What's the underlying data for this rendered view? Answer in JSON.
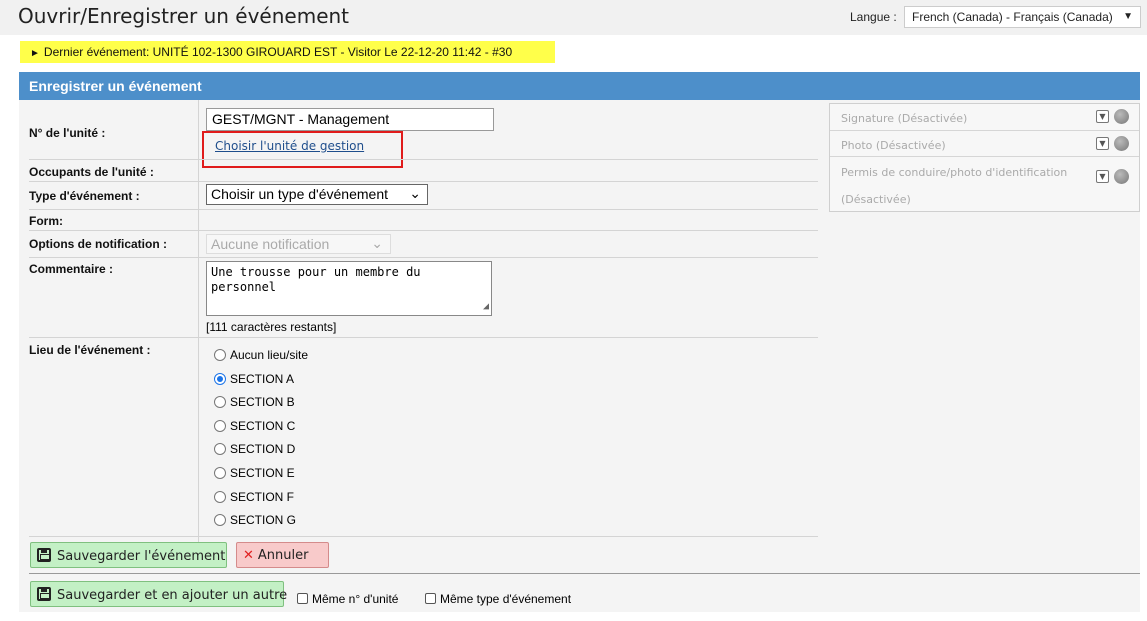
{
  "header": {
    "title": "Ouvrir/Enregistrer un événement",
    "language_label": "Langue :",
    "language_value": "French (Canada) - Français (Canada)"
  },
  "banner": {
    "text": "Dernier événement: UNITÉ 102-1300 GIROUARD EST - Visitor Le 22-12-20 11:42 - #30"
  },
  "panel": {
    "title": "Enregistrer un événement"
  },
  "form": {
    "unit_label": "N° de l'unité :",
    "unit_value": "GEST/MGNT - Management",
    "choose_unit_link": "Choisir l'unité de gestion",
    "occupants_label": "Occupants de l'unité :",
    "event_type_label": "Type d'événement :",
    "event_type_value": "Choisir un type d'événement",
    "form_label": "Form:",
    "notification_label": "Options de notification :",
    "notification_value": "Aucune notification",
    "comment_label": "Commentaire :",
    "comment_value": "Une trousse pour un membre du personnel",
    "chars_remaining": "[111 caractères restants]",
    "location_label": "Lieu de l'événement :",
    "locations": [
      {
        "label": "Aucun lieu/site",
        "checked": false
      },
      {
        "label": "SECTION A",
        "checked": true
      },
      {
        "label": "SECTION B",
        "checked": false
      },
      {
        "label": "SECTION C",
        "checked": false
      },
      {
        "label": "SECTION D",
        "checked": false
      },
      {
        "label": "SECTION E",
        "checked": false
      },
      {
        "label": "SECTION F",
        "checked": false
      },
      {
        "label": "SECTION G",
        "checked": false
      }
    ]
  },
  "buttons": {
    "save": "Sauvegarder l'événement",
    "cancel": "Annuler",
    "save_add": "Sauvegarder et en ajouter un autre"
  },
  "checkboxes": {
    "same_unit": "Même n° d'unité",
    "same_type": "Même type d'événement"
  },
  "side": {
    "signature": "Signature (Désactivée)",
    "photo": "Photo (Désactivée)",
    "permit_line1": "Permis de conduire/photo d'identification",
    "permit_line2": "(Désactivée)"
  },
  "colors": {
    "header_blue": "#4d8fca",
    "banner_yellow": "#ffff4a",
    "link_blue": "#1f4e8c",
    "highlight_red": "#e01b1b"
  }
}
